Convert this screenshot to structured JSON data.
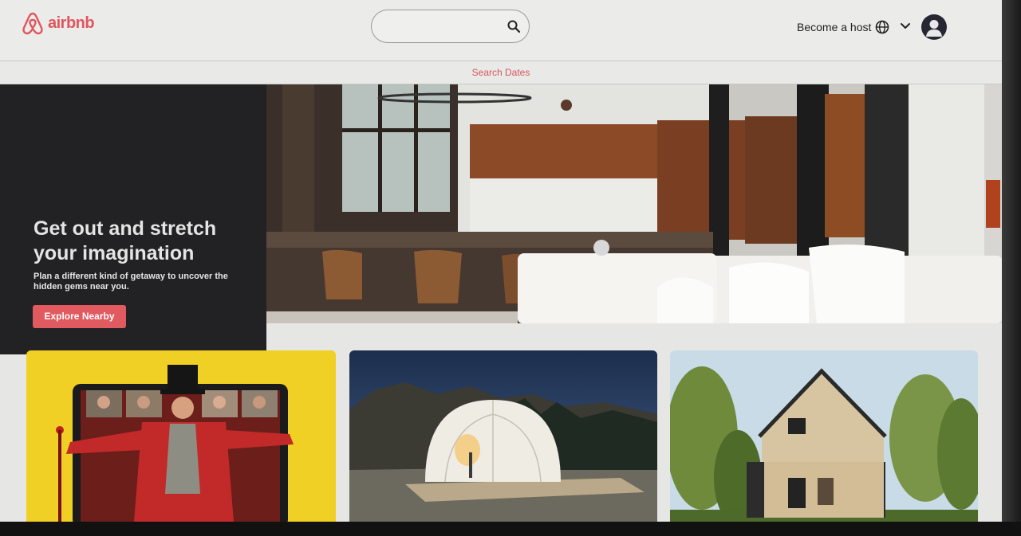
{
  "header": {
    "logo_text": "airbnb",
    "search": {
      "placeholder": ""
    },
    "become_host_label": "Become a host"
  },
  "subbar": {
    "search_dates_label": "Search Dates"
  },
  "hero": {
    "title": "Get out and stretch your imagination",
    "subtitle": "Plan a different kind of getaway to uncover the hidden gems near you.",
    "cta_label": "Explore Nearby"
  },
  "cards": [
    {
      "image": "online-experience-performer"
    },
    {
      "image": "geodesic-dome-under-night-sky"
    },
    {
      "image": "modern-a-frame-cabin-in-forest"
    }
  ],
  "colors": {
    "brand": "#e0565f",
    "hero_panel": "#222224",
    "cta": "#e05a60",
    "card1_bg": "#f0d024"
  },
  "icons": [
    "airbnb-logo-icon",
    "search-icon",
    "globe-icon",
    "chevron-down-icon",
    "user-avatar-icon"
  ]
}
